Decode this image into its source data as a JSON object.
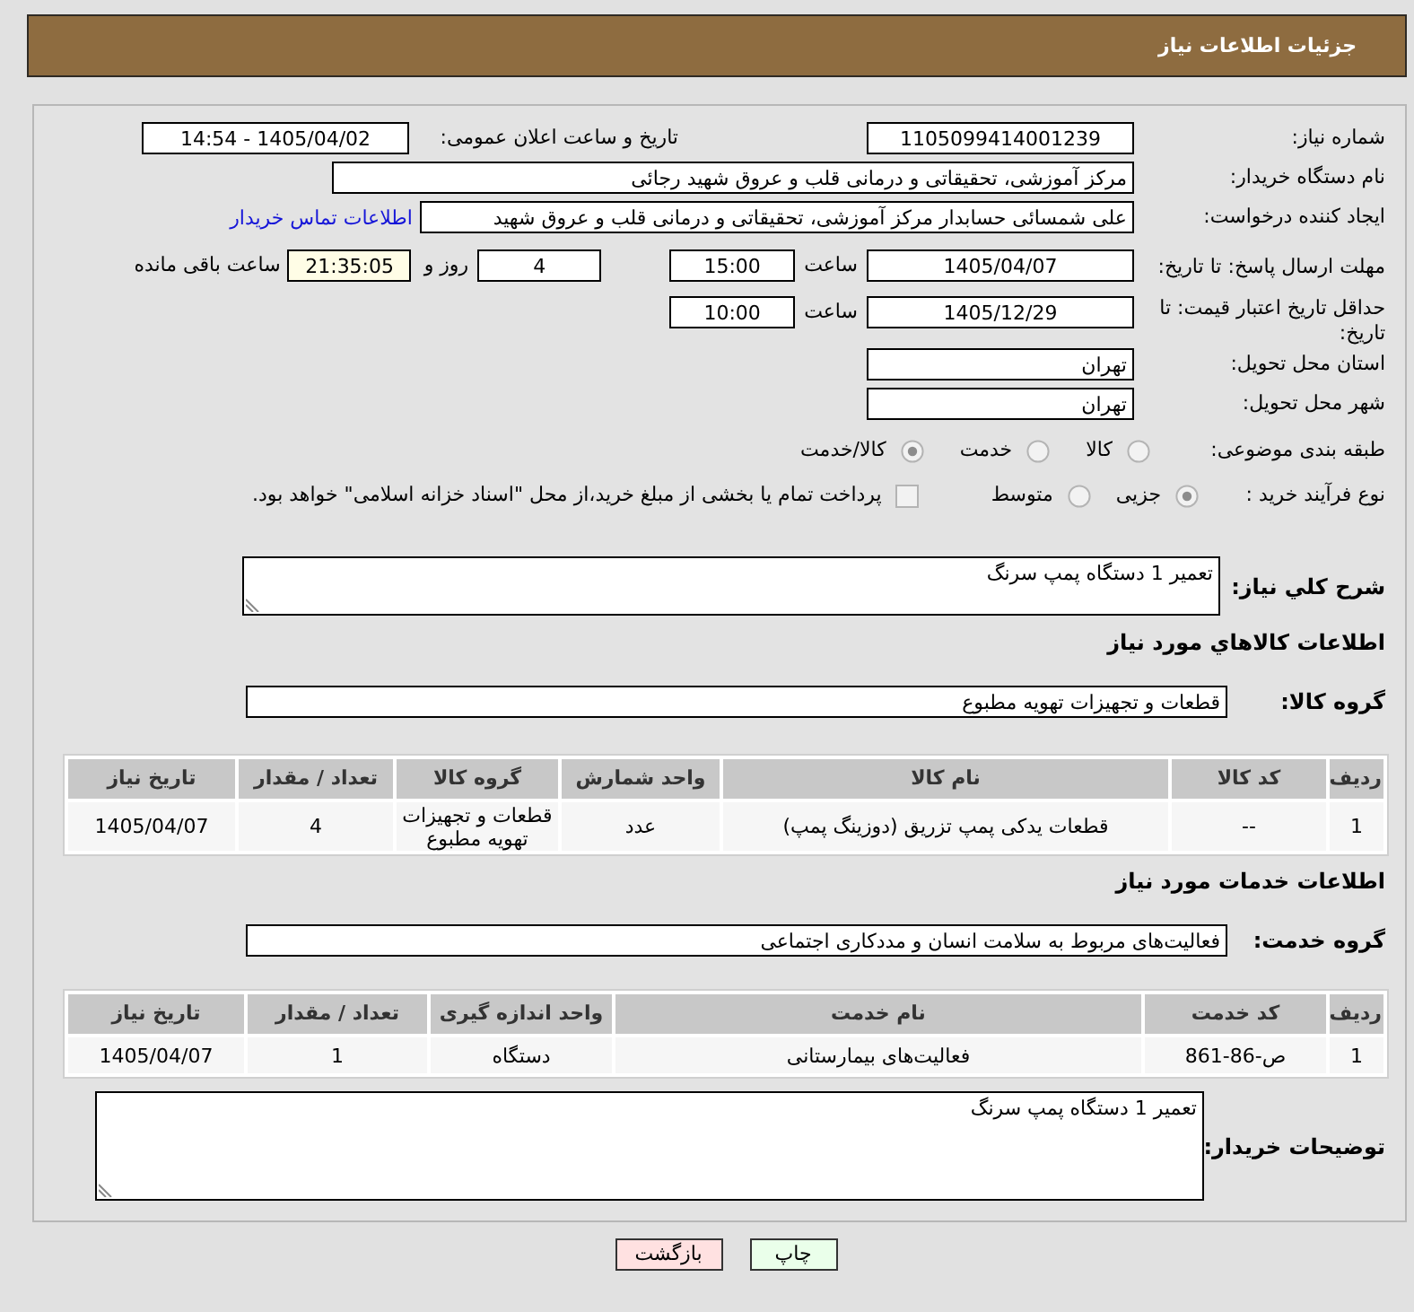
{
  "header": {
    "title": "جزئیات اطلاعات نیاز"
  },
  "need_number": {
    "label": "شماره نیاز:",
    "value": "1105099414001239"
  },
  "announcement": {
    "label": "تاریخ و ساعت اعلان عمومی:",
    "value": "1405/04/02 - 14:54"
  },
  "buyer_org": {
    "label": "نام دستگاه خریدار:",
    "value": "مرکز آموزشی، تحقیقاتی و درمانی قلب و عروق شهید رجائی"
  },
  "requester": {
    "label": "ایجاد کننده درخواست:",
    "value": "علی شمسائی حسابدار مرکز آموزشی، تحقیقاتی و درمانی قلب و عروق شهید",
    "contact_link": "اطلاعات تماس خریدار"
  },
  "response_deadline": {
    "label": "مهلت ارسال پاسخ: تا تاریخ:",
    "date": "1405/04/07",
    "time_label": "ساعت",
    "time": "15:00",
    "days": "4",
    "days_label": "روز و",
    "remaining": "21:35:05",
    "remaining_label": "ساعت باقی مانده"
  },
  "price_validity": {
    "label": "حداقل تاریخ اعتبار قیمت: تا تاریخ:",
    "date": "1405/12/29",
    "time_label": "ساعت",
    "time": "10:00"
  },
  "delivery_province": {
    "label": "استان محل تحویل:",
    "value": "تهران"
  },
  "delivery_city": {
    "label": "شهر محل تحویل:",
    "value": "تهران"
  },
  "category": {
    "label": "طبقه بندی موضوعی:",
    "options": [
      {
        "label": "کالا",
        "selected": false
      },
      {
        "label": "خدمت",
        "selected": false
      },
      {
        "label": "کالا/خدمت",
        "selected": true
      }
    ]
  },
  "purchase_process": {
    "label": "نوع فرآیند خرید :",
    "options": [
      {
        "label": "جزیی",
        "selected": true
      },
      {
        "label": "متوسط",
        "selected": false
      }
    ],
    "treasury_payment": {
      "label": "پرداخت تمام یا بخشی از مبلغ خرید،از محل \"اسناد خزانه اسلامی\" خواهد بود.",
      "checked": false
    }
  },
  "description": {
    "label": "شرح کلي نياز:",
    "value": "تعمیر 1 دستگاه پمپ سرنگ"
  },
  "goods": {
    "title": "اطلاعات کالاهاي مورد نياز",
    "group_label": "گروه کالا:",
    "group": "قطعات و تجهیزات تهویه مطبوع",
    "table": {
      "columns": [
        "ردیف",
        "کد کالا",
        "نام کالا",
        "واحد شمارش",
        "گروه کالا",
        "تعداد / مقدار",
        "تاریخ نیاز"
      ],
      "rows": [
        [
          "1",
          "--",
          "قطعات یدکی پمپ تزریق (دوزینگ پمپ)",
          "عدد",
          "قطعات و تجهیزات تهویه مطبوع",
          "4",
          "1405/04/07"
        ]
      ]
    }
  },
  "services": {
    "title": "اطلاعات خدمات مورد نياز",
    "group_label": "گروه خدمت:",
    "group": "فعالیت‌های مربوط به سلامت انسان و مددکاری اجتماعی",
    "table": {
      "columns": [
        "ردیف",
        "کد خدمت",
        "نام خدمت",
        "واحد اندازه گیری",
        "تعداد / مقدار",
        "تاریخ نیاز"
      ],
      "rows": [
        [
          "1",
          "ص-86-861",
          "فعالیت‌های بیمارستانی",
          "دستگاه",
          "1",
          "1405/04/07"
        ]
      ]
    }
  },
  "buyer_notes": {
    "label": "توضیحات خریدار:",
    "value": "تعمیر 1 دستگاه پمپ سرنگ"
  },
  "buttons": [
    {
      "label": "چاپ",
      "kind": "print"
    },
    {
      "label": "بازگشت",
      "kind": "back"
    }
  ]
}
